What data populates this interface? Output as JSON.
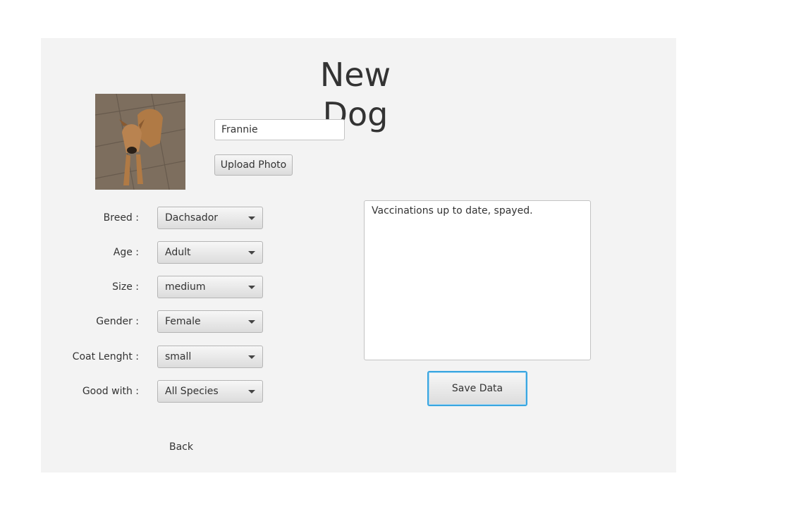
{
  "title": "New Dog",
  "photo": {
    "alt": "dog photo"
  },
  "name_field": {
    "value": "Frannie"
  },
  "upload_button": "Upload Photo",
  "form": {
    "fields": [
      {
        "label": "Breed :",
        "value": "Dachsador"
      },
      {
        "label": "Age :",
        "value": "Adult"
      },
      {
        "label": "Size :",
        "value": "medium"
      },
      {
        "label": "Gender :",
        "value": "Female"
      },
      {
        "label": "Coat Lenght :",
        "value": "small"
      },
      {
        "label": "Good with :",
        "value": "All Species"
      }
    ]
  },
  "notes": "Vaccinations up to date, spayed.",
  "save_button": "Save Data",
  "back_link": "Back",
  "colors": {
    "panel_bg": "#f3f3f3",
    "focus_border": "#3aa6e0"
  }
}
